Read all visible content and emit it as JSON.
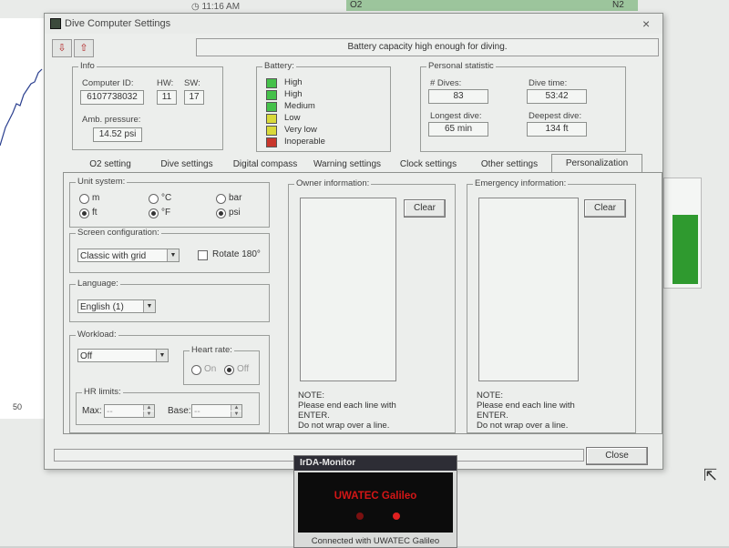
{
  "background": {
    "clock_text": "11:16 AM",
    "header_left": "O2",
    "header_right": "N2",
    "axis_tick": "50"
  },
  "window": {
    "title": "Dive Computer Settings",
    "status_message": "Battery capacity high enough for diving.",
    "close_label": "×",
    "toolbar": {
      "button1_icon": "download-from-computer-icon",
      "button2_icon": "upload-to-computer-icon"
    }
  },
  "info": {
    "group_label": "Info",
    "computer_id_label": "Computer ID:",
    "computer_id": "6107738032",
    "hw_label": "HW:",
    "hw": "11",
    "sw_label": "SW:",
    "sw": "17",
    "amb_pressure_label": "Amb. pressure:",
    "amb_pressure": "14.52 psi"
  },
  "battery": {
    "group_label": "Battery:",
    "levels": [
      {
        "label": "High",
        "color": "#45c14a"
      },
      {
        "label": "High",
        "color": "#45c14a"
      },
      {
        "label": "Medium",
        "color": "#45c14a"
      },
      {
        "label": "Low",
        "color": "#d9d93a"
      },
      {
        "label": "Very low",
        "color": "#d9d93a"
      },
      {
        "label": "Inoperable",
        "color": "#c8362b"
      }
    ]
  },
  "personal": {
    "group_label": "Personal statistic",
    "dives_label": "# Dives:",
    "dives": "83",
    "dive_time_label": "Dive time:",
    "dive_time": "53:42",
    "longest_label": "Longest dive:",
    "longest": "65 min",
    "deepest_label": "Deepest dive:",
    "deepest": "134 ft"
  },
  "tabs": [
    "O2 setting",
    "Dive settings",
    "Digital compass",
    "Warning settings",
    "Clock settings",
    "Other settings",
    "Personalization"
  ],
  "active_tab": "Personalization",
  "units": {
    "group_label": "Unit system:",
    "options": [
      "m",
      "ft",
      "°C",
      "°F",
      "bar",
      "psi"
    ],
    "selected": [
      "ft",
      "°F",
      "psi"
    ]
  },
  "screen": {
    "group_label": "Screen configuration:",
    "selected": "Classic with grid",
    "rotate_label": "Rotate 180°",
    "rotate_checked": false
  },
  "language": {
    "group_label": "Language:",
    "selected": "English (1)"
  },
  "workload": {
    "group_label": "Workload:",
    "selected": "Off",
    "heart_rate_label": "Heart rate:",
    "heart_on_label": "On",
    "heart_off_label": "Off",
    "heart_selected": "Off",
    "hr_limits_label": "HR limits:",
    "max_label": "Max:",
    "max_value": "--",
    "base_label": "Base:",
    "base_value": "--"
  },
  "owner": {
    "group_label": "Owner information:",
    "clear_label": "Clear",
    "note": "NOTE:\nPlease end each line with\nENTER.\nDo not wrap over a line."
  },
  "emergency": {
    "group_label": "Emergency information:",
    "clear_label": "Clear",
    "note": "NOTE:\nPlease end each line with\nENTER.\nDo not wrap over a line."
  },
  "footer": {
    "close_label": "Close"
  },
  "irda": {
    "title": "IrDA-Monitor",
    "brand": "UWATEC Galileo",
    "led_colors": [
      "#7a1010",
      "#e02020"
    ],
    "status": "Connected with UWATEC Galileo"
  }
}
